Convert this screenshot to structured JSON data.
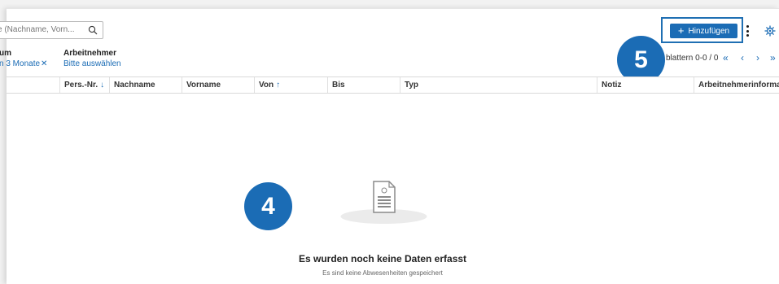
{
  "search": {
    "placeholder": "e (Nachname, Vorn..."
  },
  "filters": {
    "datum": {
      "label": "um",
      "value": "n 3 Monate"
    },
    "arbeitnehmer": {
      "label": "Arbeitnehmer",
      "value": "Bitte auswählen"
    }
  },
  "toolbar": {
    "add_label": "Hinzufügen"
  },
  "pager": {
    "text": "blattern 0-0 / 0",
    "first": "«",
    "prev": "‹",
    "next": "›",
    "last": "»"
  },
  "table": {
    "columns": [
      {
        "label": "Pers.-Nr.",
        "sort": "↓"
      },
      {
        "label": "Nachname",
        "sort": ""
      },
      {
        "label": "Vorname",
        "sort": ""
      },
      {
        "label": "Von",
        "sort": "↑"
      },
      {
        "label": "Bis",
        "sort": ""
      },
      {
        "label": "Typ",
        "sort": ""
      },
      {
        "label": "Notiz",
        "sort": ""
      },
      {
        "label": "Arbeitnehmerinformation",
        "sort": ""
      }
    ]
  },
  "empty": {
    "title": "Es wurden noch keine Daten erfasst",
    "subtitle": "Es sind keine Abwesenheiten gespeichert"
  },
  "badges": {
    "step_add": "5",
    "step_empty": "4"
  },
  "colors": {
    "accent": "#1b6cb5",
    "highlight": "#1f6fb3"
  }
}
